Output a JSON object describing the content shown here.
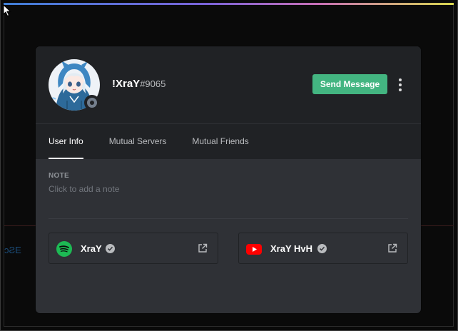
{
  "profile": {
    "username": "!XraY",
    "discriminator": "#9065",
    "status": "offline",
    "send_message_label": "Send Message",
    "more_options_icon": "more-vertical-icon"
  },
  "tabs": [
    {
      "label": "User Info",
      "active": true
    },
    {
      "label": "Mutual Servers",
      "active": false
    },
    {
      "label": "Mutual Friends",
      "active": false
    }
  ],
  "note": {
    "label": "NOTE",
    "placeholder": "Click to add a note"
  },
  "connections": [
    {
      "service": "spotify-icon",
      "name": "XraY",
      "verified": true
    },
    {
      "service": "youtube-icon",
      "name": "XraY HvH",
      "verified": true
    }
  ],
  "colors": {
    "send_button": "#43b581",
    "spotify": "#1db954",
    "youtube": "#ff0000",
    "modal_bg": "#2f3136",
    "header_bg": "#202225"
  }
}
